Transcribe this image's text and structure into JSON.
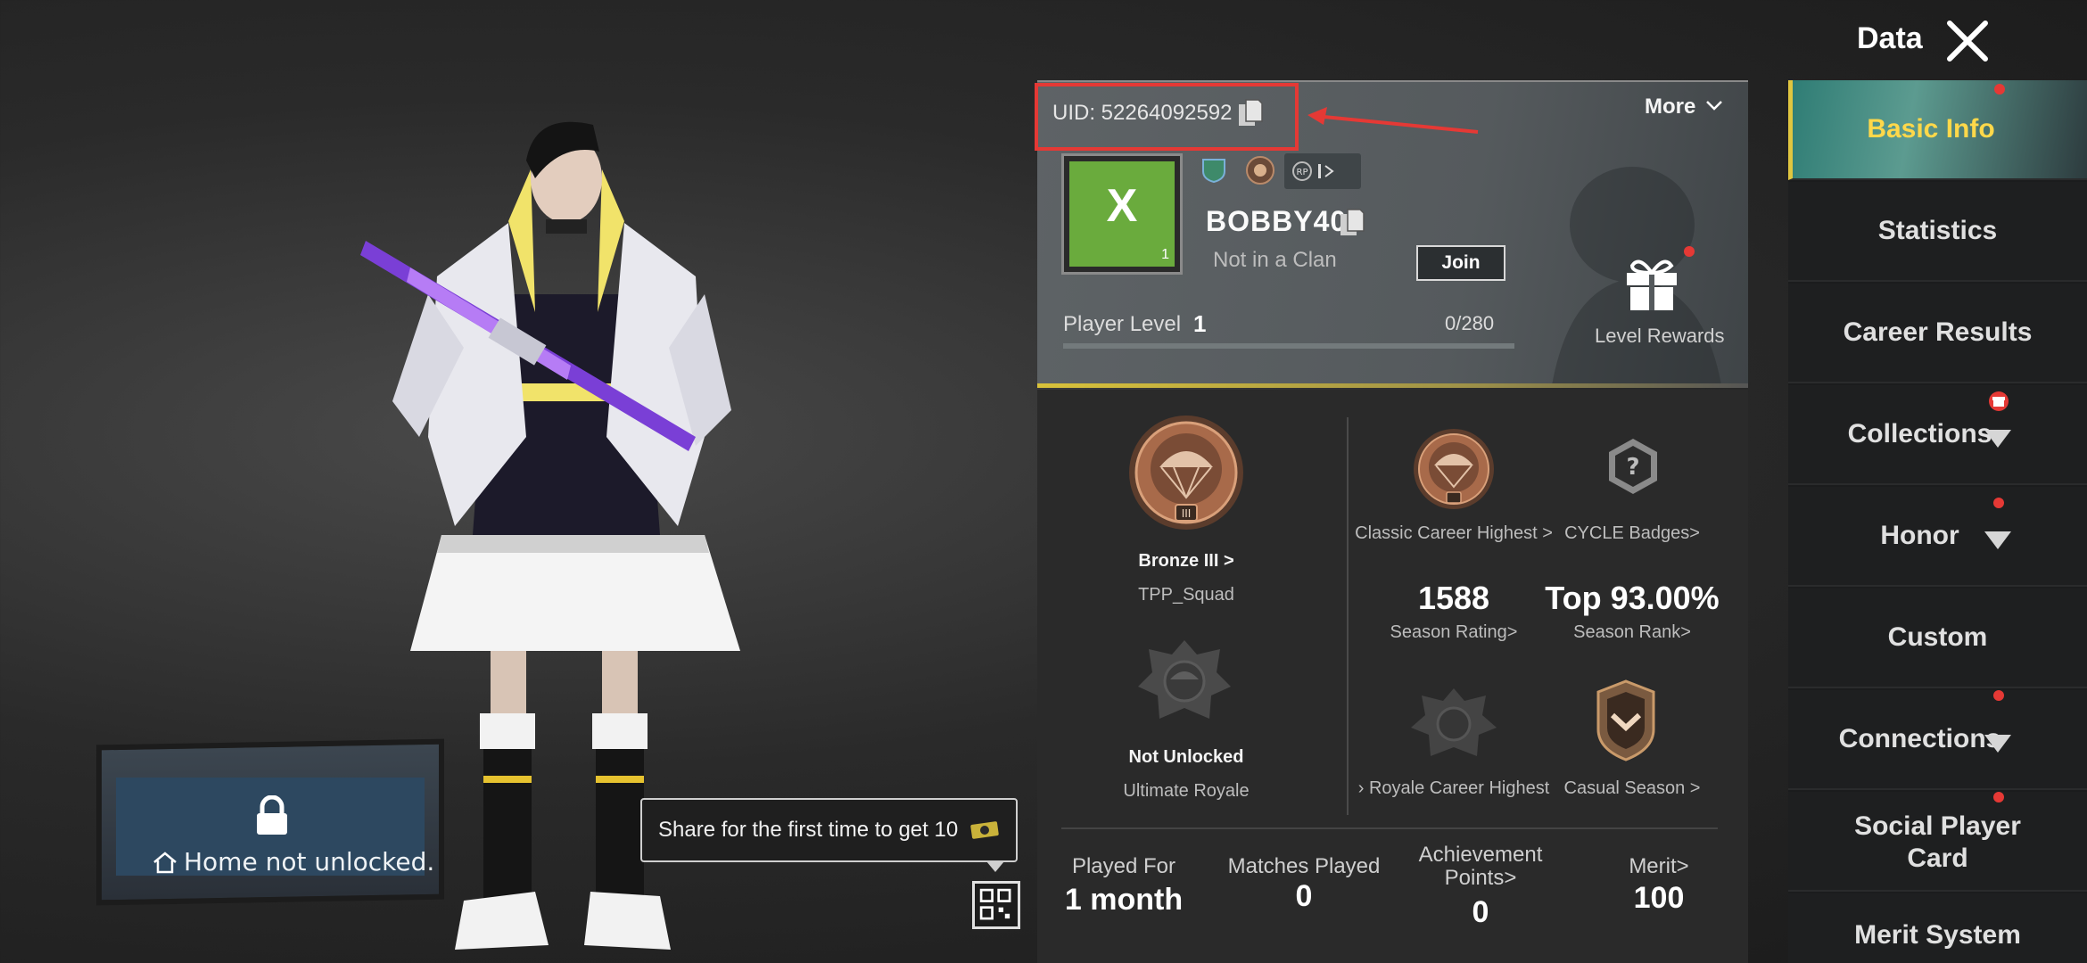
{
  "header": {
    "title": "Data"
  },
  "profile": {
    "uid": "UID: 52264092592",
    "more_label": "More",
    "avatar_letter": "X",
    "avatar_level": "1",
    "name": "BOBBY404",
    "clan_status": "Not in a Clan",
    "join_label": "Join",
    "player_level_label": "Player Level",
    "player_level_value": "1",
    "level_progress": "0/280",
    "level_progress_fraction": 0,
    "level_rewards_label": "Level Rewards"
  },
  "ranks": {
    "tpp_tier": "Bronze III >",
    "tpp_mode": "TPP_Squad",
    "tpp_tier_numeral": "III",
    "classic_highest": "Classic Career Highest >",
    "cycle_badges": "CYCLE Badges>",
    "season_rating_value": "1588",
    "season_rating_label": "Season Rating>",
    "season_rank_value": "Top 93.00%",
    "season_rank_label": "Season Rank>",
    "ultimate_status": "Not Unlocked",
    "ultimate_label": "Ultimate Royale",
    "royale_career": "› Royale Career Highest",
    "casual_season": "Casual Season >"
  },
  "summary": {
    "played_for_label": "Played For",
    "played_for_value": "1 month",
    "matches_label": "Matches Played",
    "matches_value": "0",
    "achievement_label_1": "Achievement",
    "achievement_label_2": "Points>",
    "achievement_value": "0",
    "merit_label": "Merit>",
    "merit_value": "100"
  },
  "scene": {
    "home_text": "Home not unlocked.",
    "share_text": "Share for the first time to get 10"
  },
  "sidebar": {
    "items": [
      {
        "label": "Basic Info"
      },
      {
        "label": "Statistics"
      },
      {
        "label": "Career Results"
      },
      {
        "label": "Collections"
      },
      {
        "label": "Honor"
      },
      {
        "label": "Custom"
      },
      {
        "label": "Connections"
      },
      {
        "label_1": "Social Player",
        "label_2": "Card"
      },
      {
        "label": "Merit System"
      }
    ]
  },
  "colors": {
    "accent_yellow": "#ffd84a",
    "alert_red": "#e53935",
    "avatar_green": "#6aab3d",
    "bronze": "#a86a4a"
  }
}
